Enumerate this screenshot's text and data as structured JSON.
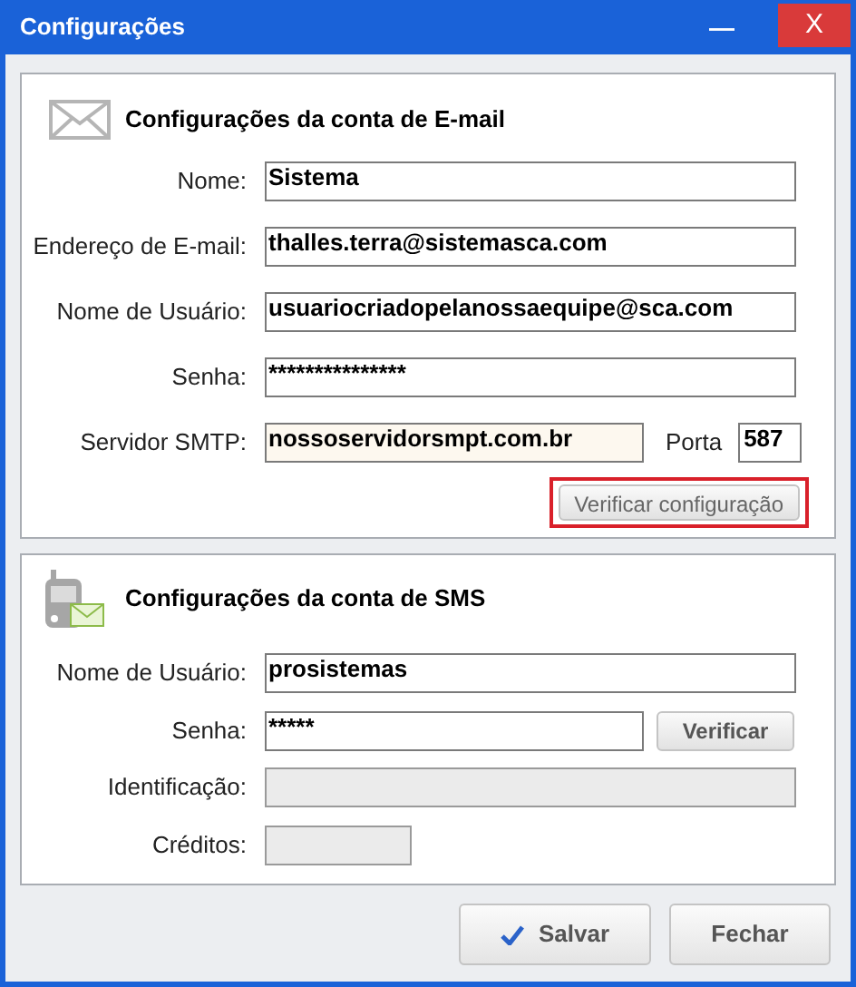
{
  "window": {
    "title": "Configurações",
    "minimize": "—",
    "close": "X"
  },
  "email_section": {
    "title": "Configurações da conta de E-mail",
    "fields": [
      {
        "label": "Nome:",
        "value": "Sistema"
      },
      {
        "label": "Endereço de E-mail:",
        "value": "thalles.terra@sistemasca.com"
      },
      {
        "label": "Nome de Usuário:",
        "value": "usuariocriadopelanossaequipe@sca.com"
      },
      {
        "label": "Senha:",
        "value": "***************"
      },
      {
        "label": "Servidor SMTP:",
        "value": "nossoservidorsmpt.com.br",
        "port_label": "Porta",
        "port_value": "587"
      }
    ],
    "verify_button": {
      "label": "Verificar configuração",
      "highlighted": true
    }
  },
  "sms_section": {
    "title": "Configurações da conta de SMS",
    "fields": [
      {
        "label": "Nome de Usuário:",
        "value": "prosistemas",
        "disabled": false
      },
      {
        "label": "Senha:",
        "value": "*****",
        "disabled": false,
        "button": "Verificar"
      },
      {
        "label": "Identificação:",
        "disabled": true
      },
      {
        "label": "Créditos:",
        "disabled": true,
        "short": true
      }
    ]
  },
  "buttons": [
    {
      "label": "Salvar",
      "kind": "confirm"
    },
    {
      "label": "Fechar",
      "kind": "plain"
    }
  ]
}
